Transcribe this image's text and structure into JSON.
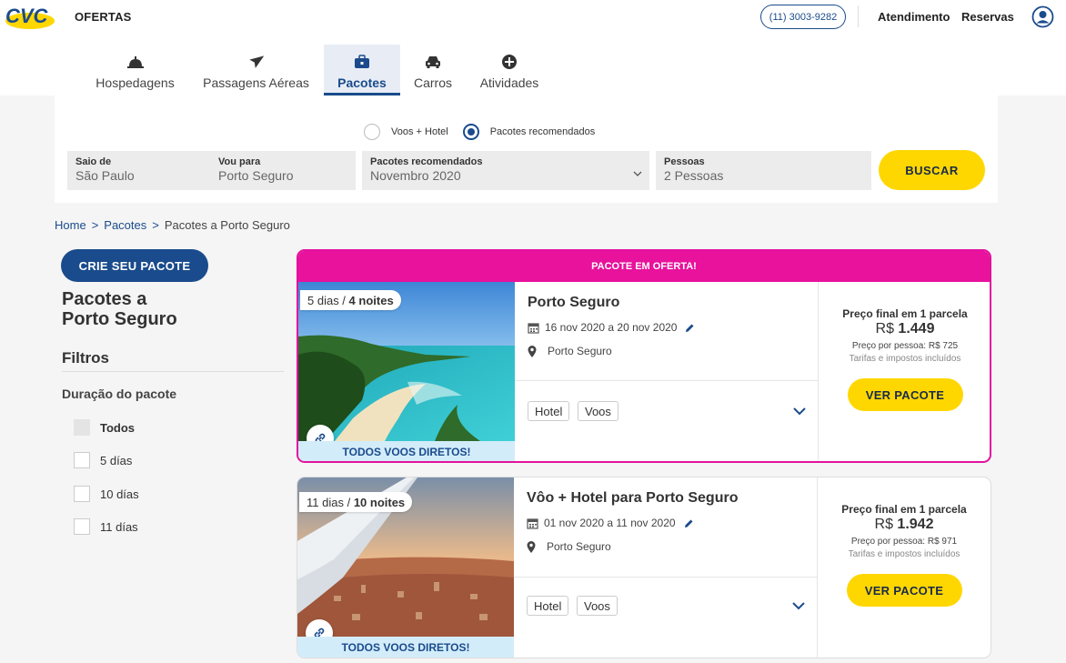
{
  "header": {
    "logo_text": "CVC",
    "ofertas": "OFERTAS",
    "phone": "(11) 3003-9282",
    "atendimento": "Atendimento",
    "reservas": "Reservas",
    "user_icon": "user-circle-icon"
  },
  "tabs": [
    {
      "label": "Hospedagens",
      "icon": "bell-icon",
      "active": false
    },
    {
      "label": "Passagens Aéreas",
      "icon": "airplane-icon",
      "active": false
    },
    {
      "label": "Pacotes",
      "icon": "briefcase-icon",
      "active": true
    },
    {
      "label": "Carros",
      "icon": "car-icon",
      "active": false
    },
    {
      "label": "Atividades",
      "icon": "plus-circle-icon",
      "active": false
    }
  ],
  "search": {
    "radio_voos_hotel": "Voos + Hotel",
    "radio_pacotes": "Pacotes recomendados",
    "selected_radio": "Pacotes recomendados",
    "origin_label": "Saio de",
    "origin_value": "São Paulo",
    "dest_label": "Vou para",
    "dest_value": "Porto Seguro",
    "pacotes_label": "Pacotes recomendados",
    "pacotes_value": "Novembro 2020",
    "pessoas_label": "Pessoas",
    "pessoas_value": "2 Pessoas",
    "buscar": "BUSCAR"
  },
  "breadcrumb": {
    "home": "Home",
    "sep": ">",
    "pacotes": "Pacotes",
    "current": "Pacotes a Porto Seguro"
  },
  "sidebar": {
    "crie": "CRIE SEU PACOTE",
    "title_line1": "Pacotes a",
    "title_line2": "Porto Seguro",
    "filtros": "Filtros",
    "duracao": "Duração do pacote",
    "options": [
      "Todos",
      "5 días",
      "10 días",
      "11 días"
    ]
  },
  "packages": [
    {
      "banner": "PACOTE EM OFERTA!",
      "duration_days": "5 dias /",
      "duration_nights": "4 noites",
      "direct": "TODOS VOOS DIRETOS!",
      "title": "Porto Seguro",
      "dates": "16 nov 2020 a 20 nov 2020",
      "place": "Porto Seguro",
      "chips": [
        "Hotel",
        "Voos"
      ],
      "price_label": "Preço final em 1 parcela",
      "currency": "R$",
      "price": "1.449",
      "per_person": "Preço por pessoa: R$ 725",
      "taxes": "Tarifas e impostos incluídos",
      "cta": "VER PACOTE"
    },
    {
      "duration_days": "11 dias /",
      "duration_nights": "10 noites",
      "direct": "TODOS VOOS DIRETOS!",
      "title": "Vôo + Hotel para Porto Seguro",
      "dates": "01 nov 2020 a 11 nov 2020",
      "place": "Porto Seguro",
      "chips": [
        "Hotel",
        "Voos"
      ],
      "price_label": "Preço final em 1 parcela",
      "currency": "R$",
      "price": "1.942",
      "per_person": "Preço por pessoa: R$ 971",
      "taxes": "Tarifas e impostos incluídos",
      "cta": "VER PACOTE"
    }
  ],
  "colors": {
    "brand_blue": "#1a4b8c",
    "cta_yellow": "#ffd700",
    "offer_pink": "#e8129c",
    "direct_bg": "#d3ecfa"
  }
}
